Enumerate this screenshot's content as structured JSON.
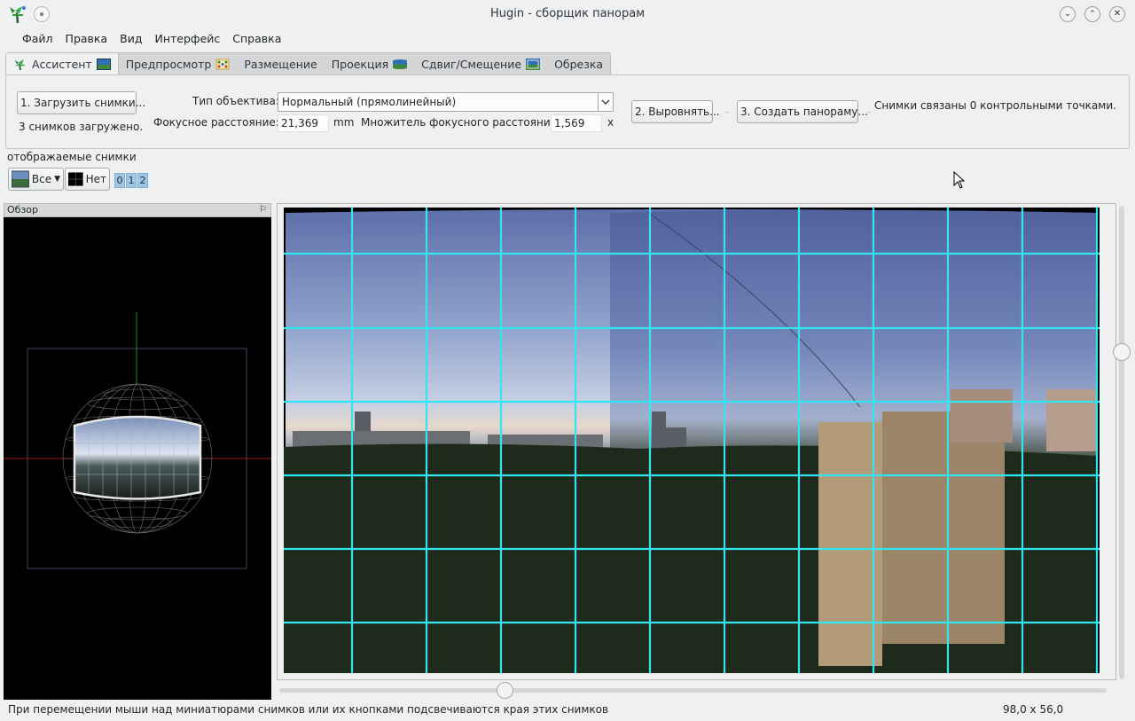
{
  "window": {
    "title": "Hugin - сборщик панорам",
    "controls": [
      "minimize",
      "maximize",
      "close"
    ]
  },
  "menu": [
    "Файл",
    "Правка",
    "Вид",
    "Интерфейс",
    "Справка"
  ],
  "tabs": [
    {
      "label": "Ассистент",
      "icon": "hugin-icon",
      "active": true
    },
    {
      "label": "Предпросмотр",
      "icon": "preview-icon"
    },
    {
      "label": "Размещение",
      "icon": "layout-icon"
    },
    {
      "label": "Проекция",
      "icon": "projection-icon"
    },
    {
      "label": "Сдвиг/Смещение",
      "icon": "shift-icon"
    },
    {
      "label": "Обрезка",
      "icon": "crop-icon"
    }
  ],
  "assistant": {
    "load_button": "1. Загрузить снимки...",
    "loaded_status": "3 снимков загружено.",
    "lens_type_label": "Тип объектива:",
    "lens_type_value": "Нормальный (прямолинейный)",
    "focal_length_label": "Фокусное расстояние:",
    "focal_length_value": "21,369",
    "focal_length_unit": "mm",
    "crop_factor_label": "Множитель фокусного расстояния:",
    "crop_factor_value": "1,569",
    "crop_factor_unit": "x",
    "align_button": "2. Выровнять...",
    "create_button": "3. Создать панораму...",
    "cp_status": "Снимки связаны 0 контрольными точками."
  },
  "displayed_images": {
    "label": "отображаемые снимки",
    "all_button": "Все",
    "none_button": "Нет",
    "image_numbers": [
      "0",
      "1",
      "2"
    ]
  },
  "overview": {
    "title": "Обзор"
  },
  "status": {
    "hint": "При перемещении мыши над миниатюрами снимков или их кнопками подсвечиваются края этих снимков",
    "fov": "98,0 x 56,0"
  },
  "colors": {
    "grid": "#32e6f0",
    "accent": "#9ec7e6",
    "window_bg": "#eff0f1"
  }
}
